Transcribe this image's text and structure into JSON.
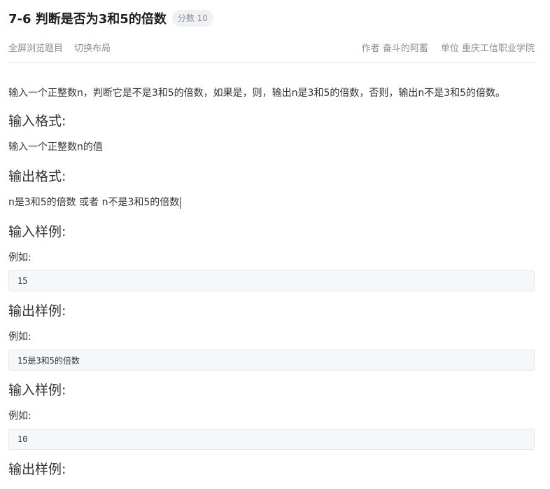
{
  "problem": {
    "title": "7-6 判断是否为3和5的倍数",
    "score_label": "分数 10"
  },
  "meta": {
    "fullscreen_label": "全屏浏览题目",
    "switch_layout_label": "切换布局",
    "author_label": "作者",
    "author_name": "奋斗的阿蓄",
    "unit_label": "单位",
    "unit_name": "重庆工信职业学院"
  },
  "description": "输入一个正整数n，判断它是不是3和5的倍数，如果是，则，输出n是3和5的倍数，否则，输出n不是3和5的倍数。",
  "sections": {
    "input_format": {
      "heading": "输入格式:",
      "text": "输入一个正整数n的值"
    },
    "output_format": {
      "heading": "输出格式:",
      "text": "n是3和5的倍数 或者 n不是3和5的倍数"
    },
    "sample_input_1": {
      "heading": "输入样例:",
      "intro": "例如:",
      "code": "15"
    },
    "sample_output_1": {
      "heading": "输出样例:",
      "intro": "例如:",
      "code": "15是3和5的倍数"
    },
    "sample_input_2": {
      "heading": "输入样例:",
      "intro": "例如:",
      "code": "10"
    },
    "sample_output_2": {
      "heading": "输出样例:"
    }
  }
}
